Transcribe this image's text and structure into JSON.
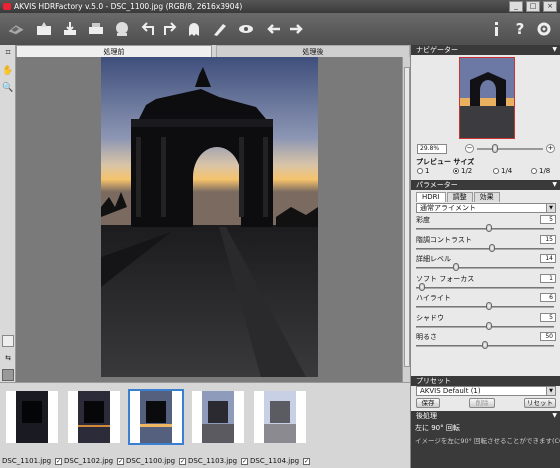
{
  "window": {
    "title": "AKVIS HDRFactory v.5.0 - DSC_1100.jpg (RGB/8, 2616x3904)",
    "min": "_",
    "max": "□",
    "close": "×"
  },
  "toolbar": {
    "help": "?"
  },
  "view_tabs": {
    "before": "処理前",
    "after": "処理後"
  },
  "film": [
    {
      "name": "DSC_1101.jpg",
      "checked": "✓"
    },
    {
      "name": "DSC_1102.jpg",
      "checked": "✓"
    },
    {
      "name": "DSC_1100.jpg",
      "checked": "✓"
    },
    {
      "name": "DSC_1103.jpg",
      "checked": "✓"
    },
    {
      "name": "DSC_1104.jpg",
      "checked": "✓"
    }
  ],
  "navigator": {
    "title": "ナビゲーター",
    "zoom": "29.8%"
  },
  "preview_size": {
    "title": "プレビュー サイズ",
    "options": [
      "1",
      "1/2",
      "1/4",
      "1/8"
    ],
    "selected": "1/2"
  },
  "params": {
    "title": "パラメーター",
    "tabs": [
      "HDRI",
      "調整",
      "効果"
    ],
    "mode": "通常アライメント",
    "items": [
      {
        "label": "彩度",
        "value": "5",
        "level": 0.53
      },
      {
        "label": "階調コントラスト",
        "value": "15",
        "level": 0.55
      },
      {
        "label": "詳細レベル",
        "value": "14",
        "level": 0.28
      },
      {
        "label": "ソフト フォーカス",
        "value": "1",
        "level": 0.02
      },
      {
        "label": "ハイライト",
        "value": "6",
        "level": 0.53
      },
      {
        "label": "シャドウ",
        "value": "5",
        "level": 0.53
      },
      {
        "label": "明るさ",
        "value": "50",
        "level": 0.5
      }
    ]
  },
  "presets": {
    "title": "プリセット",
    "value": "AKVIS Default (1)",
    "save": "保存",
    "delete": "削除",
    "reset": "リセット"
  },
  "postprocess": {
    "title": "後処理",
    "subtitle": "左に 90° 回転",
    "desc": "イメージを左に90° 回転させることができます(CCW)。"
  },
  "colors": {
    "accent": "#3a7fd0",
    "dark_header": "#3a3a3a"
  }
}
